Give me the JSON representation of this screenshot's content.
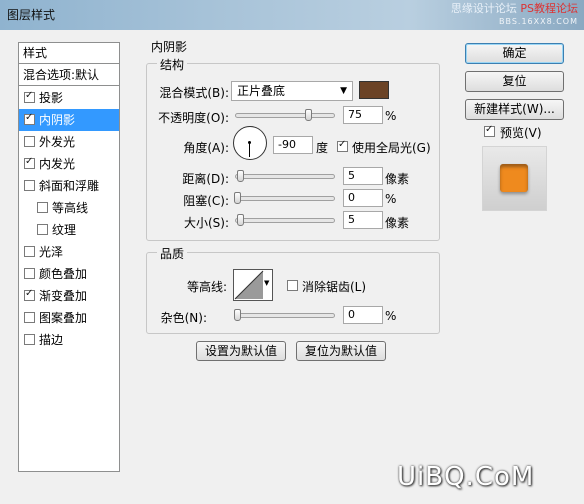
{
  "window": {
    "title": "图层样式"
  },
  "watermark_top": {
    "line1": "思缘设计论坛",
    "line2": "PS教程论坛",
    "line3": "BBS.16XX8.COM"
  },
  "left_panel": {
    "header": "样式",
    "blend_options": "混合选项:默认",
    "items": [
      {
        "label": "投影",
        "checked": true,
        "selected": false
      },
      {
        "label": "内阴影",
        "checked": true,
        "selected": true
      },
      {
        "label": "外发光",
        "checked": false,
        "selected": false
      },
      {
        "label": "内发光",
        "checked": true,
        "selected": false
      },
      {
        "label": "斜面和浮雕",
        "checked": false,
        "selected": false
      },
      {
        "label": "等高线",
        "checked": false,
        "selected": false
      },
      {
        "label": "纹理",
        "checked": false,
        "selected": false
      },
      {
        "label": "光泽",
        "checked": false,
        "selected": false
      },
      {
        "label": "颜色叠加",
        "checked": false,
        "selected": false
      },
      {
        "label": "渐变叠加",
        "checked": true,
        "selected": false
      },
      {
        "label": "图案叠加",
        "checked": false,
        "selected": false
      },
      {
        "label": "描边",
        "checked": false,
        "selected": false
      }
    ]
  },
  "inner_shadow": {
    "title": "内阴影",
    "structure": {
      "title": "结构",
      "blend_mode_label": "混合模式(B):",
      "blend_mode_value": "正片叠底",
      "color": "#6b4326",
      "opacity_label": "不透明度(O):",
      "opacity_value": "75",
      "opacity_unit": "%",
      "opacity_fraction": 0.75,
      "angle_label": "角度(A):",
      "angle_value": "-90",
      "angle_unit": "度",
      "global_light_label": "使用全局光(G)",
      "global_light_checked": true,
      "distance_label": "距离(D):",
      "distance_value": "5",
      "distance_unit": "像素",
      "choke_label": "阻塞(C):",
      "choke_value": "0",
      "choke_unit": "%",
      "size_label": "大小(S):",
      "size_value": "5",
      "size_unit": "像素"
    },
    "quality": {
      "title": "品质",
      "contour_label": "等高线:",
      "anti_alias_label": "消除锯齿(L)",
      "anti_alias_checked": false,
      "noise_label": "杂色(N):",
      "noise_value": "0",
      "noise_unit": "%"
    },
    "set_default_button": "设置为默认值",
    "reset_default_button": "复位为默认值"
  },
  "right_panel": {
    "ok_button": "确定",
    "reset_button": "复位",
    "new_style_button": "新建样式(W)...",
    "preview_label": "预览(V)",
    "preview_checked": true,
    "preview_color": "#ef8a1e"
  },
  "watermark_bottom": "UiBQ.CoM"
}
